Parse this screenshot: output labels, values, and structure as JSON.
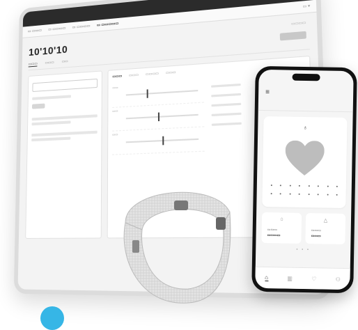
{
  "tablet": {
    "window_title": "",
    "tabs": [],
    "breadcrumb": "",
    "heading": "10'10'10",
    "subtabs": [],
    "left_panel": {
      "field_value": "",
      "section_title": ""
    },
    "right_panel": {
      "tabs": [],
      "title": ""
    }
  },
  "phone": {
    "status_time": "",
    "header_left": "",
    "header_right": "",
    "card_caption": "",
    "heart_value": "",
    "heart_unit": "",
    "card_sub": "",
    "tiles": [],
    "nav": [
      "home-icon",
      "chart-icon",
      "heart-icon",
      "person-icon"
    ]
  },
  "colors": {
    "accent_blob": "#36b6e6",
    "heart": "#bdbdbd",
    "phone_frame": "#111111"
  }
}
